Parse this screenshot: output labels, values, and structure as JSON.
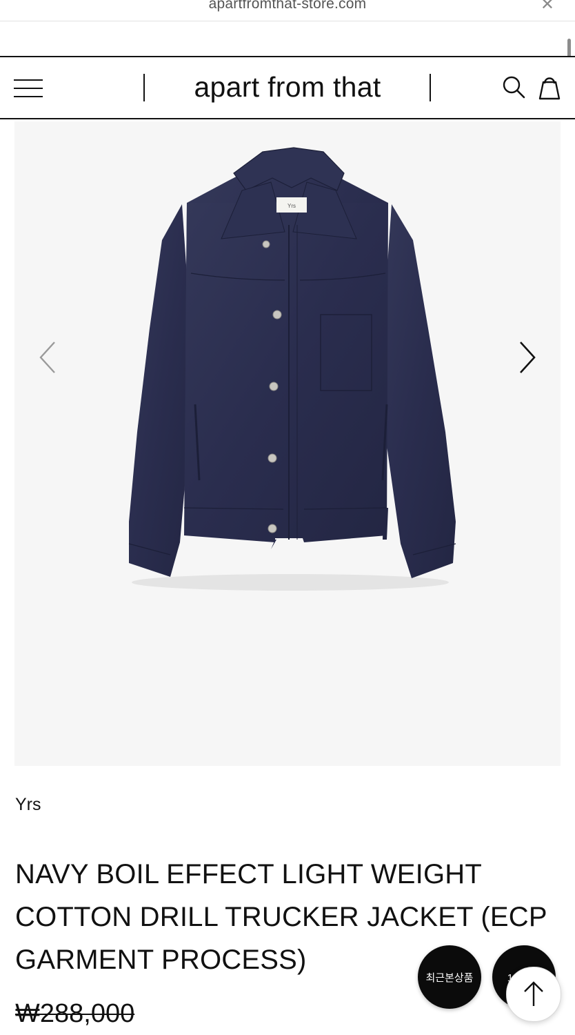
{
  "browser": {
    "url": "apartfromthat-store.com",
    "close_glyph": "✕"
  },
  "header": {
    "logo": "apart from that",
    "icons": [
      "menu-icon",
      "search-icon",
      "shopping-bag-icon"
    ]
  },
  "gallery": {
    "image_alt": "navy trucker jacket",
    "label_text": "Yrs",
    "prev_icon": "chevron-left-icon",
    "next_icon": "chevron-right-icon",
    "background": "#f6f6f6",
    "jacket_color": "#2a2d4e"
  },
  "product": {
    "brand": "Yrs",
    "title": "NAVY BOIL EFFECT LIGHT WEIGHT COTTON DRILL TRUCKER JACKET (ECP GARMENT PROCESS)",
    "price": "₩288,000"
  },
  "floating": {
    "recent_label": "최근본상품",
    "chat_label": "1:1문의",
    "top_icon": "arrow-up-icon"
  }
}
